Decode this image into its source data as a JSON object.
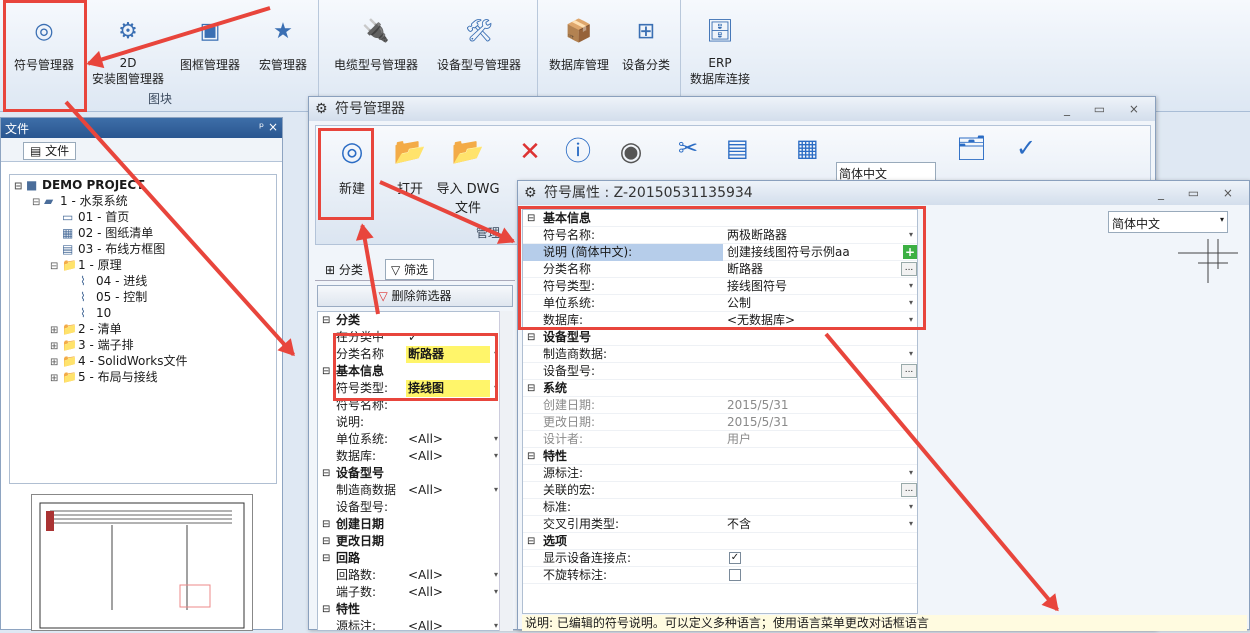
{
  "ribbon": {
    "buttons": [
      {
        "label": "符号管理器",
        "icon": "symbol-manager-icon"
      },
      {
        "label": "2D",
        "label2": "安装图管理器",
        "icon": "2d-layout-icon"
      },
      {
        "label": "图框管理器",
        "icon": "title-block-icon"
      },
      {
        "label": "宏管理器",
        "icon": "macro-star-icon"
      },
      {
        "label": "电缆型号管理器",
        "icon": "cable-icon"
      },
      {
        "label": "设备型号管理器",
        "icon": "device-tools-icon"
      },
      {
        "label": "数据库管理",
        "icon": "database-box-icon"
      },
      {
        "label": "设备分类",
        "icon": "classification-tree-icon"
      },
      {
        "label": "ERP",
        "label2": "数据库连接",
        "icon": "erp-database-icon"
      }
    ],
    "group_label": "图块"
  },
  "file_panel": {
    "title": "文件",
    "pin": "ᵖ ×",
    "tab": "文件",
    "tree": [
      {
        "label": "DEMO PROJECT",
        "level": 0,
        "bold": true,
        "icon": "project-icon"
      },
      {
        "label": "1 - 水泵系统",
        "level": 1,
        "icon": "book-icon"
      },
      {
        "label": "01 - 首页",
        "level": 2,
        "icon": "page-icon"
      },
      {
        "label": "02 - 图纸清单",
        "level": 2,
        "icon": "list-sheet-icon"
      },
      {
        "label": "03 - 布线方框图",
        "level": 2,
        "icon": "block-diagram-icon"
      },
      {
        "label": "1 - 原理",
        "level": 2,
        "icon": "folder-icon"
      },
      {
        "label": "04 - 进线",
        "level": 3,
        "icon": "schematic-icon"
      },
      {
        "label": "05 - 控制",
        "level": 3,
        "icon": "schematic-icon"
      },
      {
        "label": "10",
        "level": 3,
        "icon": "schematic-icon"
      },
      {
        "label": "2 - 清单",
        "level": 2,
        "icon": "folder-icon"
      },
      {
        "label": "3 - 端子排",
        "level": 2,
        "icon": "folder-icon"
      },
      {
        "label": "4 - SolidWorks文件",
        "level": 2,
        "icon": "folder-icon"
      },
      {
        "label": "5 - 布局与接线",
        "level": 2,
        "icon": "folder-icon"
      }
    ]
  },
  "symbol_manager": {
    "title": "符号管理器",
    "toolbar": [
      {
        "label": "新建",
        "icon": "new-symbol-icon"
      },
      {
        "label": "打开",
        "icon": "open-folder-icon"
      },
      {
        "label": "导入 DWG",
        "label2": "文件",
        "icon": "import-dwg-icon"
      },
      {
        "label": "",
        "icon": "delete-x-icon"
      },
      {
        "label": "",
        "icon": "info-icon"
      },
      {
        "label": "",
        "icon": "symbol-preview-icon"
      }
    ],
    "group_label": "管理",
    "tabs": [
      "分类",
      "筛选"
    ],
    "clear_filter": "删除筛选器",
    "lang": "简体中文",
    "filter_rows": [
      {
        "type": "sec",
        "label": "分类"
      },
      {
        "type": "row",
        "label": "在分类中",
        "value": "✓"
      },
      {
        "type": "row",
        "label": "分类名称",
        "value": "断路器",
        "hl": true
      },
      {
        "type": "sec",
        "label": "基本信息"
      },
      {
        "type": "row",
        "label": "符号类型:",
        "value": "接线图",
        "hl": true
      },
      {
        "type": "row",
        "label": "符号名称:",
        "value": ""
      },
      {
        "type": "row",
        "label": "说明:",
        "value": ""
      },
      {
        "type": "row",
        "label": "单位系统:",
        "value": "<All>"
      },
      {
        "type": "row",
        "label": "数据库:",
        "value": "<All>"
      },
      {
        "type": "sec",
        "label": "设备型号"
      },
      {
        "type": "row",
        "label": "制造商数据",
        "value": "<All>"
      },
      {
        "type": "row",
        "label": "设备型号:",
        "value": ""
      },
      {
        "type": "sec",
        "label": "创建日期"
      },
      {
        "type": "sec",
        "label": "更改日期"
      },
      {
        "type": "sec",
        "label": "回路"
      },
      {
        "type": "row",
        "label": "回路数:",
        "value": "<All>"
      },
      {
        "type": "row",
        "label": "端子数:",
        "value": "<All>"
      },
      {
        "type": "sec",
        "label": "特性"
      },
      {
        "type": "row",
        "label": "源标注:",
        "value": "<All>"
      }
    ]
  },
  "properties": {
    "title": "符号属性 :  Z-20150531135934",
    "lang": "简体中文",
    "rows": [
      {
        "type": "sec",
        "label": "基本信息"
      },
      {
        "type": "row",
        "label": "符号名称:",
        "value": "两极断路器"
      },
      {
        "type": "row",
        "label": "说明 (简体中文):",
        "value": "创建接线图符号示例aa",
        "sel": true
      },
      {
        "type": "row",
        "label": "分类名称",
        "value": "断路器"
      },
      {
        "type": "row",
        "label": "符号类型:",
        "value": "接线图符号"
      },
      {
        "type": "row",
        "label": "单位系统:",
        "value": "公制"
      },
      {
        "type": "row",
        "label": "数据库:",
        "value": "<无数据库>"
      },
      {
        "type": "sec",
        "label": "设备型号"
      },
      {
        "type": "row",
        "label": "制造商数据:",
        "value": ""
      },
      {
        "type": "row",
        "label": "设备型号:",
        "value": ""
      },
      {
        "type": "sec",
        "label": "系统"
      },
      {
        "type": "row",
        "label": "创建日期:",
        "value": "2015/5/31",
        "gray": true
      },
      {
        "type": "row",
        "label": "更改日期:",
        "value": "2015/5/31",
        "gray": true
      },
      {
        "type": "row",
        "label": "设计者:",
        "value": "用户",
        "gray": true
      },
      {
        "type": "sec",
        "label": "特性"
      },
      {
        "type": "row",
        "label": "源标注:",
        "value": ""
      },
      {
        "type": "row",
        "label": "关联的宏:",
        "value": ""
      },
      {
        "type": "row",
        "label": "标准:",
        "value": ""
      },
      {
        "type": "row",
        "label": "交叉引用类型:",
        "value": "不含"
      },
      {
        "type": "sec",
        "label": "选项"
      },
      {
        "type": "row",
        "label": "显示设备连接点:",
        "value": "✓"
      },
      {
        "type": "row",
        "label": "不旋转标注:",
        "value": ""
      }
    ],
    "status": "说明: 已编辑的符号说明。可以定义多种语言；使用语言菜单更改对话框语言"
  },
  "colors": {
    "highlight": "#e8453c",
    "accent": "#2b6cc4"
  }
}
